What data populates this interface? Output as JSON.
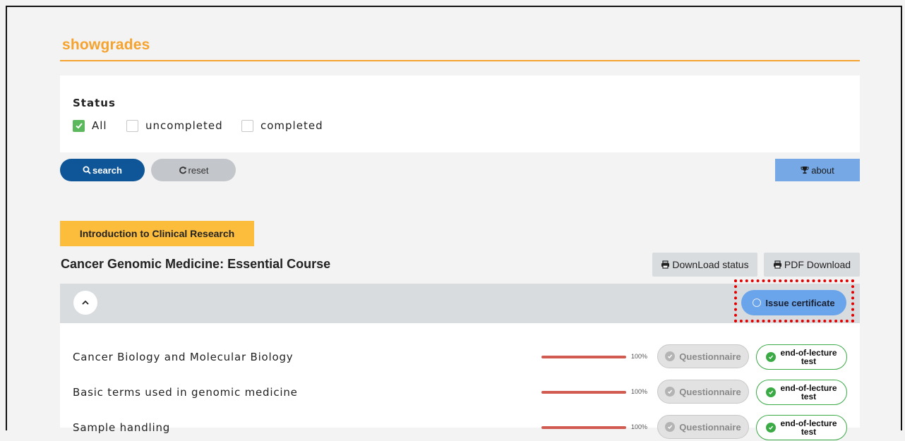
{
  "header": {
    "title": "showgrades"
  },
  "filter": {
    "status_label": "Status",
    "options": [
      {
        "label": "All",
        "checked": true
      },
      {
        "label": "uncompleted",
        "checked": false
      },
      {
        "label": "completed",
        "checked": false
      }
    ]
  },
  "actions": {
    "search_label": "search",
    "reset_label": "reset",
    "about_label": "about"
  },
  "course": {
    "tag": "Introduction to Clinical Research",
    "title": "Cancer Genomic Medicine: Essential Course",
    "download_status_label": "DownLoad status",
    "pdf_download_label": "PDF Download",
    "issue_certificate_label": "Issue certificate"
  },
  "lectures": [
    {
      "title": "Cancer Biology and Molecular Biology",
      "progress": 100,
      "progress_label": "100%",
      "questionnaire_label": "Questionnaire",
      "test_label_line1": "end-of-lecture",
      "test_label_line2": "test"
    },
    {
      "title": "Basic terms used in genomic medicine",
      "progress": 100,
      "progress_label": "100%",
      "questionnaire_label": "Questionnaire",
      "test_label_line1": "end-of-lecture",
      "test_label_line2": "test"
    },
    {
      "title": "Sample handling",
      "progress": 100,
      "progress_label": "100%",
      "questionnaire_label": "Questionnaire",
      "test_label_line1": "end-of-lecture",
      "test_label_line2": "test"
    }
  ],
  "colors": {
    "accent": "#f5a32e",
    "search_button": "#0e5698",
    "about_button": "#77a8e6",
    "course_tag": "#fcbc3c",
    "issue_button": "#6aa4ea",
    "progress_fill": "#d15b50",
    "complete_green": "#3aaa45",
    "highlight": "#e00000"
  },
  "icons": [
    "check-icon",
    "search-icon",
    "reset-icon",
    "trophy-icon",
    "printer-icon",
    "chevron-up-icon",
    "circle-icon"
  ]
}
